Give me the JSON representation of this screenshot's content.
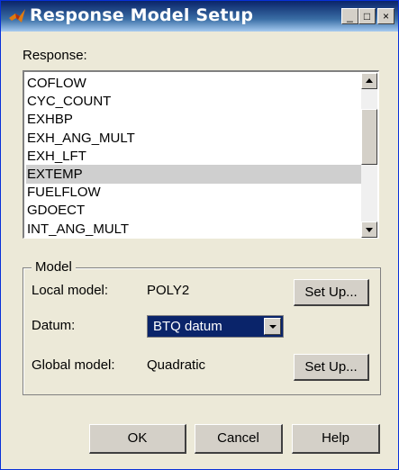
{
  "window": {
    "title": "Response Model Setup",
    "controls": {
      "minimize": "_",
      "maximize": "□",
      "close": "×"
    },
    "icon": "matlab-logo-icon"
  },
  "response": {
    "label": "Response:",
    "items": [
      "COFLOW",
      "CYC_COUNT",
      "EXHBP",
      "EXH_ANG_MULT",
      "EXH_LFT",
      "EXTEMP",
      "FUELFLOW",
      "GDOECT",
      "INT_ANG_MULT"
    ],
    "selected_index": 5
  },
  "model": {
    "group_label": "Model",
    "local_label": "Local model:",
    "local_value": "POLY2",
    "local_setup": "Set Up...",
    "datum_label": "Datum:",
    "datum_value": "BTQ datum",
    "global_label": "Global model:",
    "global_value": "Quadratic",
    "global_setup": "Set Up..."
  },
  "buttons": {
    "ok": "OK",
    "cancel": "Cancel",
    "help": "Help"
  },
  "colors": {
    "title_bar": "#0a246a",
    "selection": "#cfcfcf",
    "select_bg": "#0a246a"
  }
}
